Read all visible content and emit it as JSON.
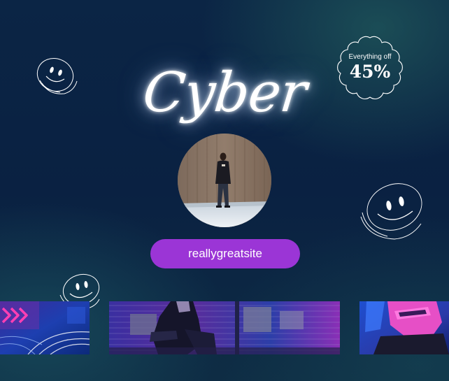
{
  "title": "Cyber",
  "badge": {
    "small_text": "Everything off",
    "big_text": "45%"
  },
  "button": {
    "label": "reallygreatsite"
  },
  "colors": {
    "background": "#0b2545",
    "button": "#9b35d6",
    "text": "#ffffff",
    "neon_pink": "#ff3fb4",
    "neon_blue": "#3a6cff"
  }
}
